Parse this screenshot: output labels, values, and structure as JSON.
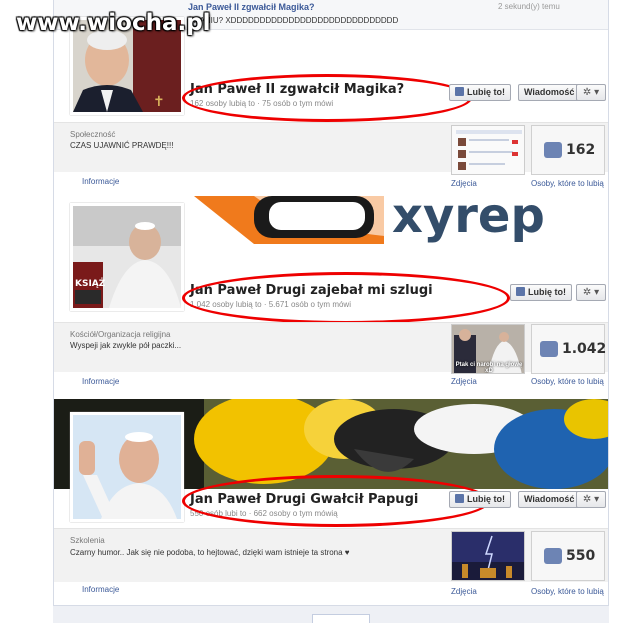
{
  "watermark": "www.wiocha.pl",
  "top_post": {
    "title": "Jan Paweł II zgwałcił Magika?",
    "text": "DRANIU? XDDDDDDDDDDDDDDDDDDDDDDDDDDDDD",
    "time": "2 sekund(y) temu"
  },
  "pages": [
    {
      "name": "Jan Paweł II zgwałcił Magika?",
      "stats": "162 osoby lubią to · 75 osób o tym mówi",
      "category": "Społeczność",
      "about": "CZAS UJAWNIĆ PRAWDĘ!!!",
      "info_tab": "Informacje",
      "photos_tab": "Zdjęcia",
      "likes_tab": "Osoby, które to lubią",
      "likes": "162",
      "like_button": "Lubię to!",
      "message_button": "Wiadomość"
    },
    {
      "name": "Jan Paweł Drugi zajebał mi szlugi",
      "stats": "1.042 osoby lubią to · 5.671 osób o tym mówi",
      "category": "Kościół/Organizacja religijna",
      "about": "Wyspeji jak zwykle pół paczki...",
      "info_tab": "Informacje",
      "photos_tab": "Zdjęcia",
      "likes_tab": "Osoby, które to lubią",
      "likes": "1.042",
      "like_button": "Lubię to!",
      "thumb_caption": "Ptak ci narobi na głowę xD",
      "sticker_label": "KSIĄŻ"
    },
    {
      "name": "Jan Paweł Drugi Gwałcił Papugi",
      "stats": "550 osób lubi to · 662 osoby o tym mówią",
      "category": "Szkolenia",
      "about": "Czarny humor.. Jak się nie podoba, to hejtować, dzięki wam istnieje ta strona ♥",
      "info_tab": "Informacje",
      "photos_tab": "Zdjęcia",
      "likes_tab": "Osoby, które to lubią",
      "likes": "550",
      "like_button": "Lubię to!",
      "message_button": "Wiadomość"
    }
  ],
  "colors": {
    "highlight_oval": "#e00000",
    "fb_blue": "#3b5998",
    "parrot_yellow": "#f2c200",
    "parrot_blue": "#1f63b0"
  }
}
